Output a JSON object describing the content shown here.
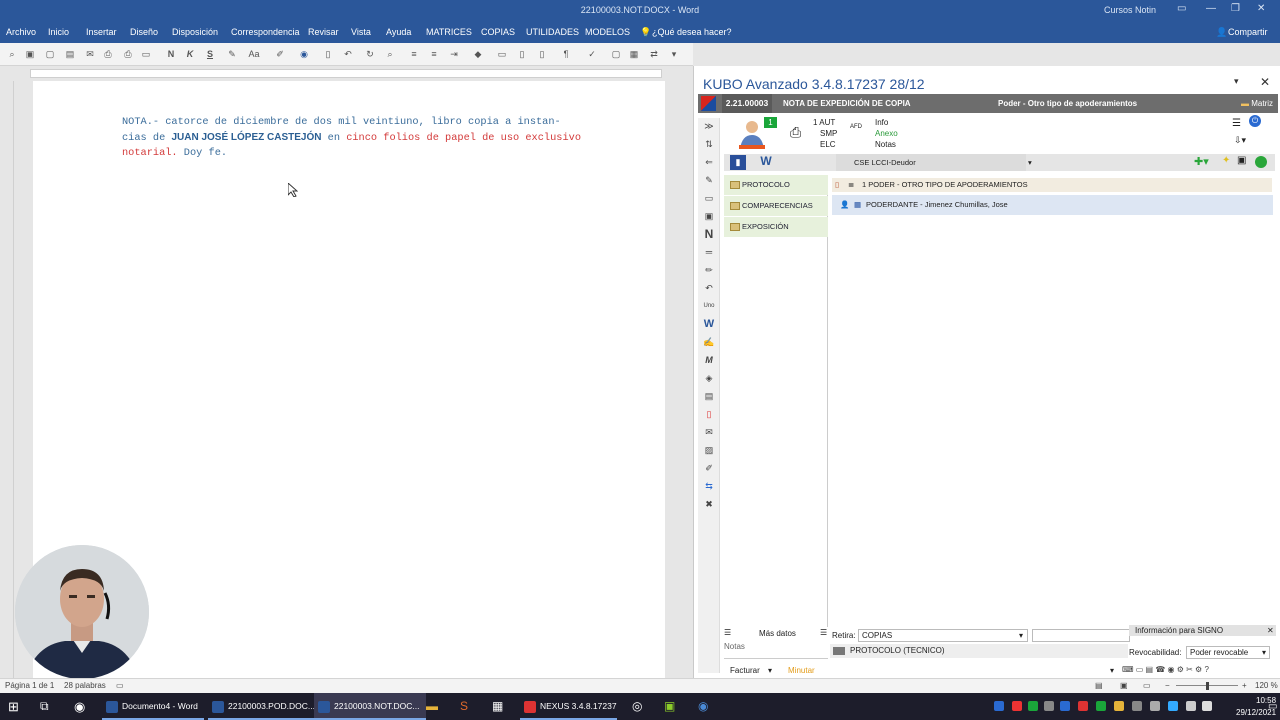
{
  "word": {
    "title": "22100003.NOT.DOCX - Word",
    "user": "Cursos Notin",
    "share": "Compartir",
    "menu": [
      "Archivo",
      "Inicio",
      "Insertar",
      "Diseño",
      "Disposición",
      "Correspondencia",
      "Revisar",
      "Vista",
      "Ayuda",
      "MATRICES",
      "COPIAS",
      "UTILIDADES",
      "MODELOS"
    ],
    "tell_me": "¿Qué desea hacer?",
    "doc": {
      "p1": "NOTA.- catorce de diciembre de dos mil veintiuno, libro copia a instan-",
      "p2a": "cias de ",
      "p2name": "JUAN JOSÉ LÓPEZ CASTEJÓN",
      "p2b": " en ",
      "p2red": "cinco folios de papel de uso exclusivo",
      "p3red": "notarial.",
      "p3b": " Doy fe."
    },
    "status": {
      "page": "Página 1 de 1",
      "words": "28 palabras",
      "zoom": "120 %"
    }
  },
  "kubo": {
    "title": "KUBO Avanzado 3.4.8.17237   28/12",
    "code": "2.21.00003",
    "nota": "NOTA DE EXPEDICIÓN DE COPIA",
    "poder": "Poder - Otro tipo de apoderamientos",
    "matriz": "Matriz",
    "badge": "1",
    "aut": "1 AUT",
    "smp": "SMP",
    "elc": "ELC",
    "afd": "AFD",
    "info": "Info",
    "anexo": "Anexo",
    "notas_link": "Notas",
    "combo": "CSE LCCI-Deudor",
    "nav": [
      "PROTOCOLO",
      "COMPARECENCIAS",
      "EXPOSICIÓN"
    ],
    "tree": [
      "1 PODER - OTRO TIPO DE APODERAMIENTOS",
      "PODERDANTE - Jimenez Chumillas, Jose"
    ],
    "mas_datos": "Más datos",
    "notas": "Notas",
    "facturar": "Facturar",
    "minutar": "Minutar",
    "retira_label": "Retira:",
    "retira_value": "COPIAS",
    "protocolo_tecnico": "PROTOCOLO (TECNICO)",
    "signo": "Información para SIGNO",
    "revocabilidad_label": "Revocabilidad:",
    "revocabilidad_value": "Poder revocable",
    "uno": "Uno"
  },
  "taskbar": {
    "items": [
      "Documento4 - Word",
      "22100003.POD.DOC...",
      "22100003.NOT.DOC...",
      "NEXUS  3.4.8.17237"
    ],
    "time": "10:58",
    "date": "29/12/2021"
  },
  "colors": {
    "word_blue": "#2b579a",
    "nav_green": "#e7f1dc",
    "doc_blue": "#3a6c9a",
    "doc_red": "#d33a3a"
  }
}
